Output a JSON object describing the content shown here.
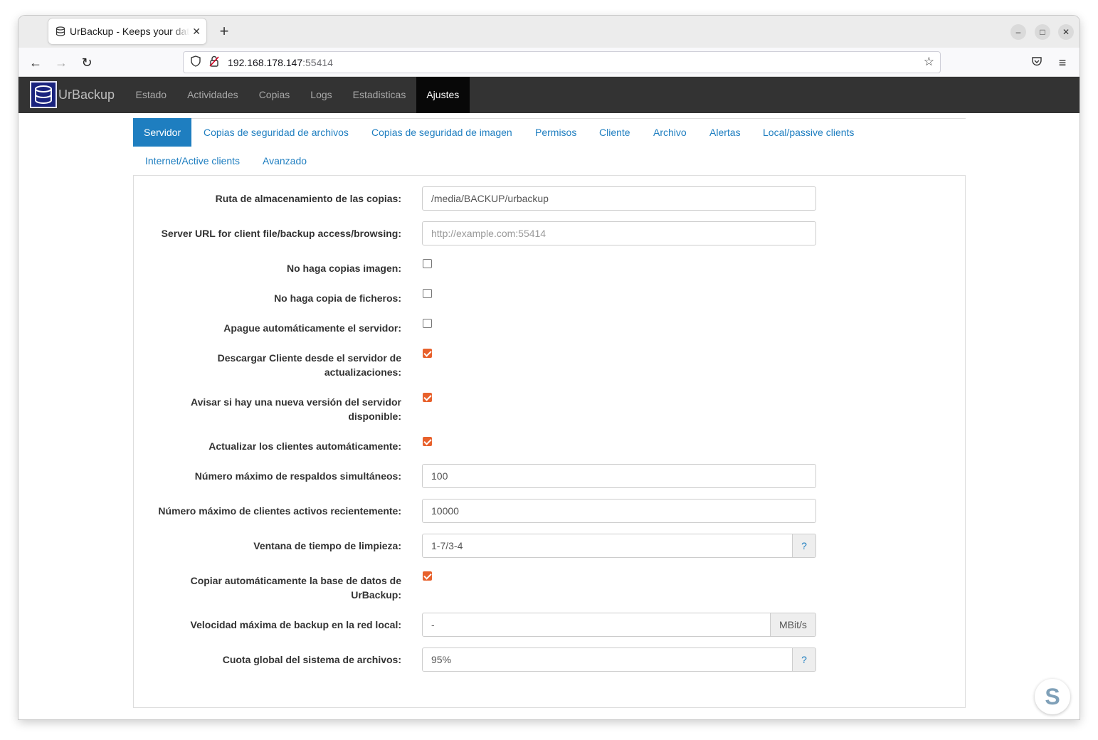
{
  "browser": {
    "tab_title": "UrBackup - Keeps your data safe",
    "tab_close": "✕",
    "new_tab": "+",
    "url_host": "192.168.178.147",
    "url_port": ":55414",
    "window_controls": {
      "minimize": "–",
      "maximize": "□",
      "close": "✕"
    },
    "icons": {
      "back": "←",
      "forward": "→",
      "reload": "↻",
      "star": "☆",
      "pocket": "pocket-icon",
      "menu": "≡"
    }
  },
  "app": {
    "brand": "UrBackup",
    "nav": [
      "Estado",
      "Actividades",
      "Copias",
      "Logs",
      "Estadisticas",
      "Ajustes"
    ],
    "active_nav": "Ajustes"
  },
  "subtabs": {
    "row1": [
      "Servidor",
      "Copias de seguridad de archivos",
      "Copias de seguridad de imagen",
      "Permisos",
      "Cliente",
      "Archivo",
      "Alertas",
      "Local/passive clients"
    ],
    "row2": [
      "Internet/Active clients",
      "Avanzado"
    ],
    "active": "Servidor"
  },
  "settings": {
    "storage_path": {
      "label": "Ruta de almacenamiento de las copias:",
      "value": "/media/BACKUP/urbackup"
    },
    "server_url": {
      "label": "Server URL for client file/backup access/browsing:",
      "placeholder": "http://example.com:55414"
    },
    "no_image_backups": {
      "label": "No haga copias imagen:",
      "checked": false
    },
    "no_file_backups": {
      "label": "No haga copia de ficheros:",
      "checked": false
    },
    "auto_shutdown": {
      "label": "Apague automáticamente el servidor:",
      "checked": false
    },
    "download_client": {
      "label_line1": "Descargar Cliente desde el servidor de",
      "label_line2": "actualizaciones:",
      "checked": true
    },
    "notify_new_version": {
      "label_line1": "Avisar si hay una nueva versión del servidor",
      "label_line2": "disponible:",
      "checked": true
    },
    "auto_update_clients": {
      "label": "Actualizar los clientes automáticamente:",
      "checked": true
    },
    "max_simultaneous": {
      "label": "Número máximo de respaldos simultáneos:",
      "value": "100"
    },
    "max_recent_clients": {
      "label": "Número máximo de clientes activos recientemente:",
      "value": "10000"
    },
    "cleanup_window": {
      "label": "Ventana de tiempo de limpieza:",
      "value": "1-7/3-4",
      "help": "?"
    },
    "backup_database": {
      "label_line1": "Copiar automáticamente la base de datos de",
      "label_line2": "UrBackup:",
      "checked": true
    },
    "max_local_speed": {
      "label": "Velocidad máxima de backup en la red local:",
      "value": "-",
      "unit": "MBit/s"
    },
    "global_quota": {
      "label": "Cuota global del sistema de archivos:",
      "value": "95%",
      "help": "?"
    }
  },
  "colors": {
    "accent": "#1e7ec0",
    "checkbox": "#e8612c",
    "appbar": "#333333"
  }
}
